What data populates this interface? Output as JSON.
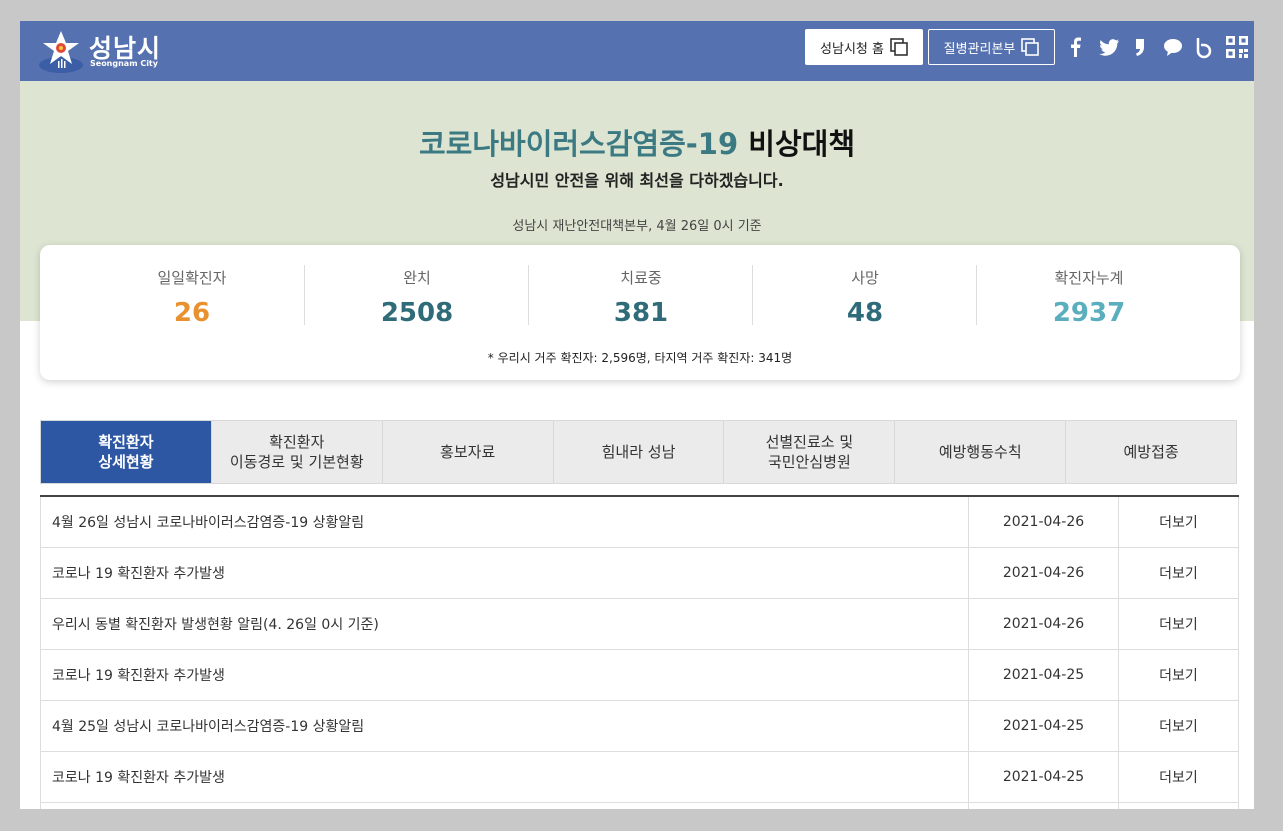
{
  "header": {
    "logo_ko": "성남시",
    "logo_en": "Seongnam City",
    "home_button": "성남시청 홈",
    "kdca_button": "질병관리본부",
    "brand_color": "#5671b0"
  },
  "hero": {
    "title_accent": "코로나바이러스감염증-19",
    "title_rest": "비상대책",
    "subtitle": "성남시민 안전을 위해 최선을 다하겠습니다.",
    "source": "성남시 재난안전대책본부, 4월 26일 0시 기준"
  },
  "stats": {
    "items": [
      {
        "label": "일일확진자",
        "value": "26",
        "color": "#e8912e"
      },
      {
        "label": "완치",
        "value": "2508",
        "color": "#2f6b78"
      },
      {
        "label": "치료중",
        "value": "381",
        "color": "#2f6b78"
      },
      {
        "label": "사망",
        "value": "48",
        "color": "#2f6b78"
      },
      {
        "label": "확진자누계",
        "value": "2937",
        "color": "#5aaebd"
      }
    ],
    "note": "* 우리시 거주 확진자: 2,596명, 타지역 거주 확진자: 341명"
  },
  "tabs": [
    {
      "label": "확진환자\n상세현황",
      "active": true
    },
    {
      "label": "확진환자\n이동경로 및 기본현황",
      "active": false
    },
    {
      "label": "홍보자료",
      "active": false
    },
    {
      "label": "힘내라 성남",
      "active": false
    },
    {
      "label": "선별진료소 및\n국민안심병원",
      "active": false
    },
    {
      "label": "예방행동수칙",
      "active": false
    },
    {
      "label": "예방접종",
      "active": false
    }
  ],
  "list": {
    "more_label": "더보기",
    "rows": [
      {
        "title": "4월 26일 성남시 코로나바이러스감염증-19 상황알림",
        "date": "2021-04-26"
      },
      {
        "title": "코로나 19 확진환자 추가발생",
        "date": "2021-04-26"
      },
      {
        "title": "우리시 동별 확진환자 발생현황 알림(4. 26일 0시 기준)",
        "date": "2021-04-26"
      },
      {
        "title": "코로나 19 확진환자 추가발생",
        "date": "2021-04-25"
      },
      {
        "title": "4월 25일 성남시 코로나바이러스감염증-19 상황알림",
        "date": "2021-04-25"
      },
      {
        "title": "코로나 19 확진환자 추가발생",
        "date": "2021-04-25"
      },
      {
        "title": "",
        "date": ""
      }
    ]
  }
}
